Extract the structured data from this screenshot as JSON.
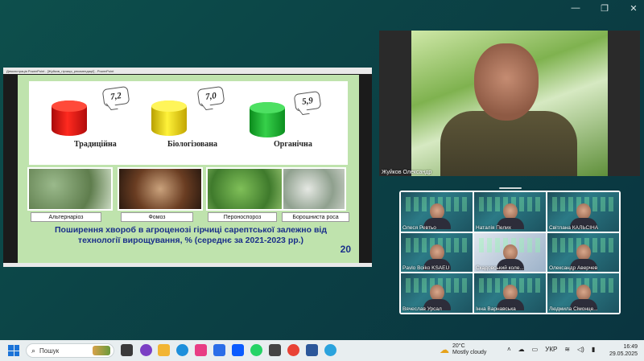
{
  "window": {
    "minimize": "—",
    "restore": "❐",
    "close": "✕"
  },
  "share": {
    "title": "Демонстрація PowerPoint - [Жуйков_гірчиця_рекомендації] - PowerPoint",
    "slide": {
      "values": [
        "7,2",
        "7,0",
        "5,9"
      ],
      "technologies": [
        "Традиційна",
        "Біологізована",
        "Органічна"
      ],
      "diseases": [
        "Альтернаріоз",
        "Фомоз",
        "Пероноспороз",
        "Борошниста роса"
      ],
      "caption_line1": "Поширення хвороб в агроценозі гірчиці сарептської залежно від",
      "caption_line2": "технології вирощування, % (середнє за 2021-2023 рр.)",
      "number": "20"
    }
  },
  "speaker": {
    "name": "Жуйков Олександр"
  },
  "participants": [
    "Олеся Ревтьо",
    "Наталія Пелих",
    "Світлана КАЛЬСІНА",
    "Pavlo Boiko KSAEU",
    "Скадовський колe...",
    "Олександр Аверчев",
    "Вячеслав Урсал",
    "Інна Варнавська",
    "Людмила Сімонце..."
  ],
  "taskbar": {
    "search_placeholder": "Пошук",
    "weather_temp": "20°C",
    "weather_desc": "Mostly cloudy",
    "language": "УКР",
    "time": "16:49",
    "date": "29.05.2025"
  },
  "colors": {
    "accent": "#1a73d8",
    "slide_bg": "#bfe3ad",
    "caption": "#1a2f8a"
  }
}
